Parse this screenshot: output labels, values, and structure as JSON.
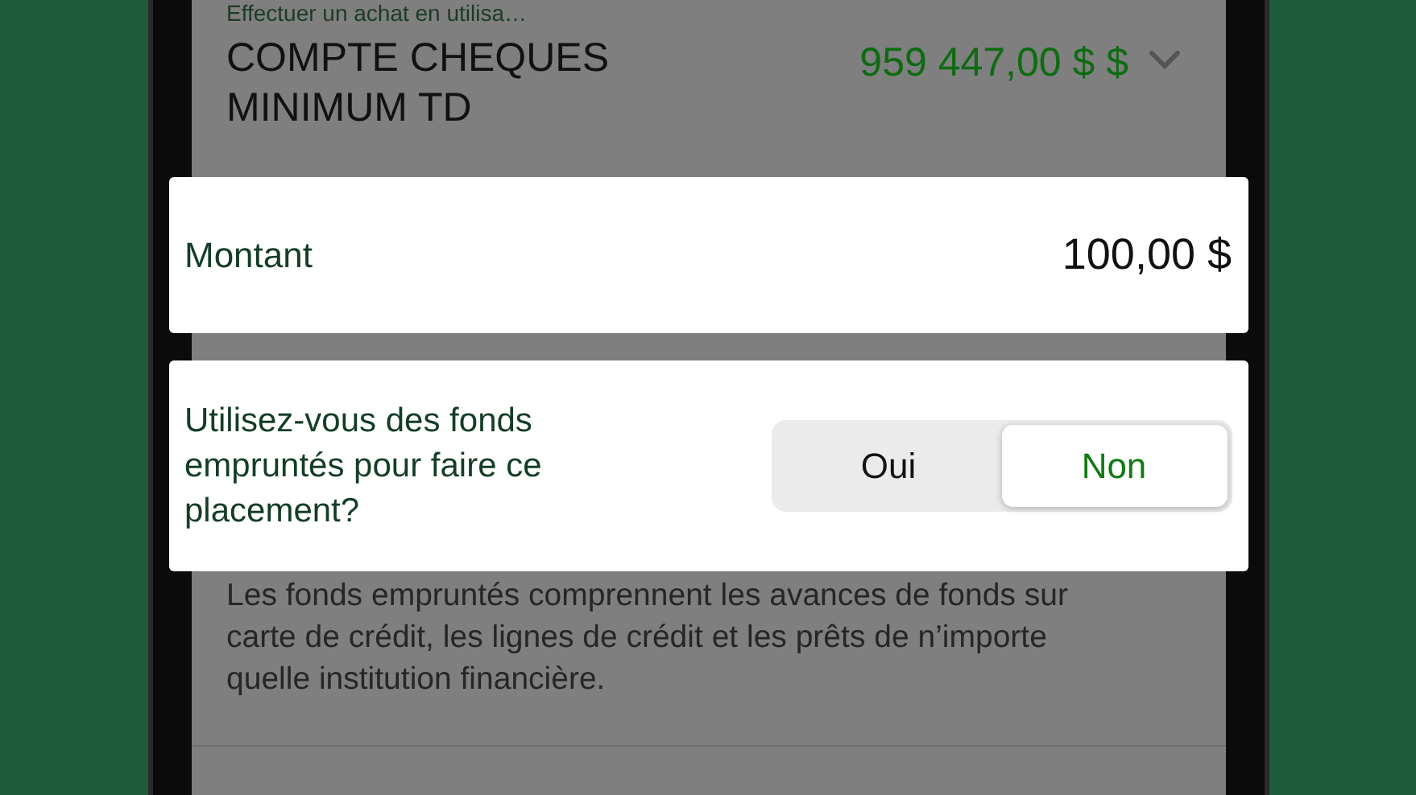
{
  "account_section": {
    "caption": "Effectuer un achat en utilisa…",
    "account_name": "COMPTE CHEQUES MINIMUM TD",
    "balance": "959 447,00 $ $"
  },
  "amount_card": {
    "label": "Montant",
    "value": "100,00 $"
  },
  "borrowed_card": {
    "question": "Utilisez-vous des fonds empruntés pour faire ce placement?",
    "options": [
      {
        "label": "Oui",
        "selected": false
      },
      {
        "label": "Non",
        "selected": true
      }
    ]
  },
  "description": "Les fonds empruntés comprennent les avances de fonds sur carte de crédit, les lignes de crédit et les prêts de n’importe quelle institution financière."
}
